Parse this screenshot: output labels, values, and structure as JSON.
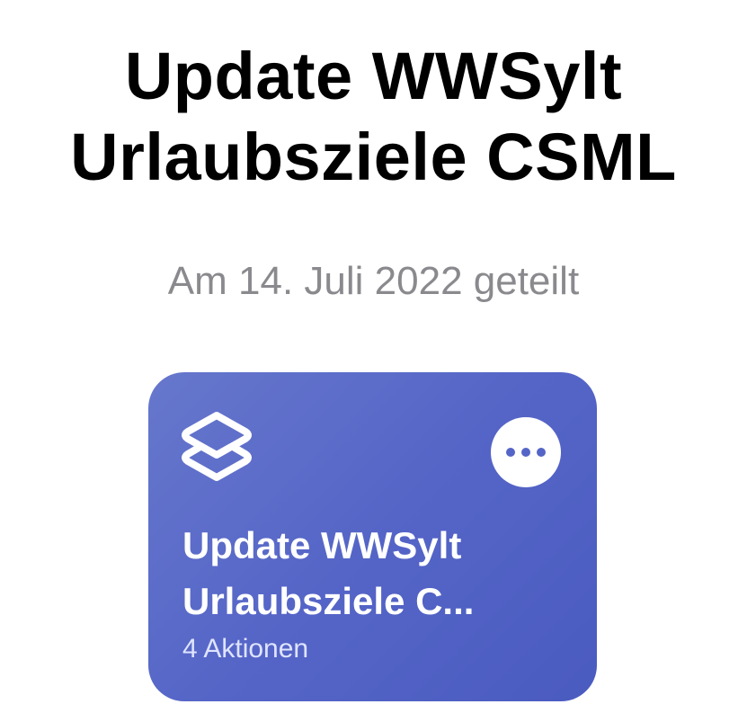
{
  "header": {
    "title_line1": "Update WWSylt",
    "title_line2": "Urlaubsziele CSML",
    "shared_date": "Am 14. Juli 2022 geteilt"
  },
  "shortcut_card": {
    "title_line1": "Update WWSylt",
    "title_line2": "Urlaubsziele C...",
    "action_count": "4 Aktionen",
    "icon": "shortcuts-layers-icon",
    "more_icon": "ellipsis-icon",
    "colors": {
      "gradient_start": "#6677cc",
      "gradient_end": "#4a5bc0",
      "text": "#ffffff",
      "subtitle": "#dfe4ff"
    }
  }
}
